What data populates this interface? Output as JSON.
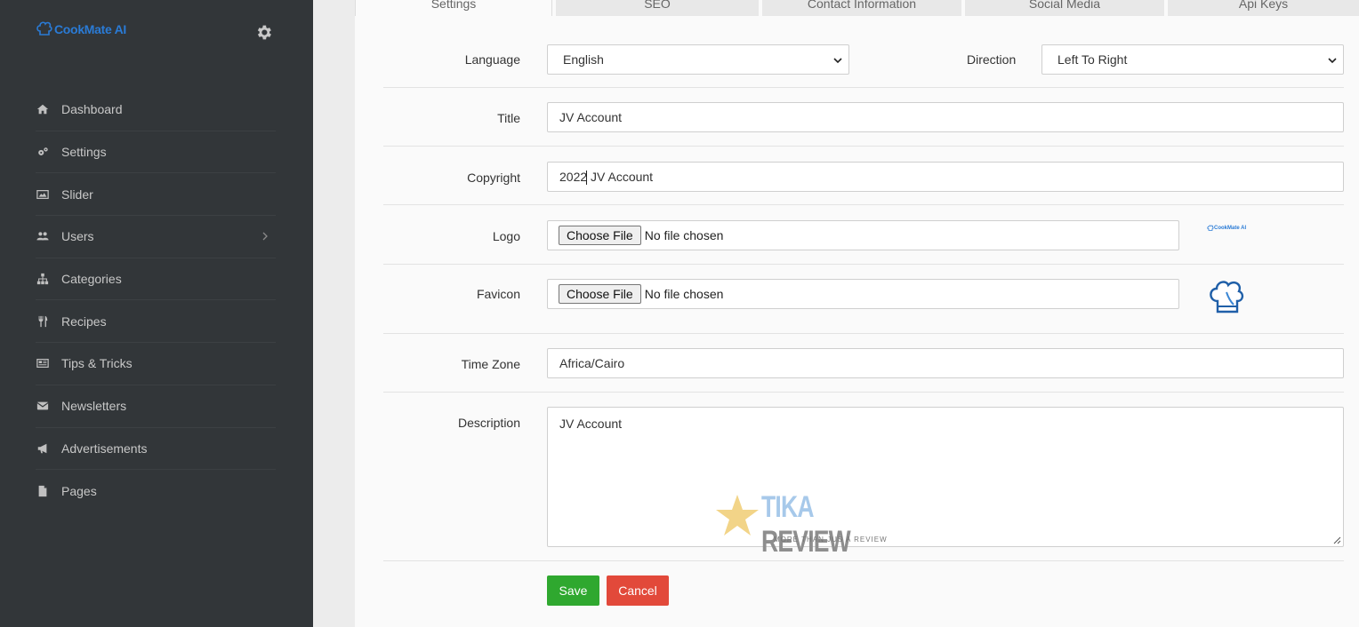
{
  "brand": {
    "name": "CookMate AI"
  },
  "sidebar": {
    "items": [
      {
        "label": "Dashboard",
        "icon": "home-icon"
      },
      {
        "label": "Settings",
        "icon": "gears-icon"
      },
      {
        "label": "Slider",
        "icon": "image-icon"
      },
      {
        "label": "Users",
        "icon": "users-icon"
      },
      {
        "label": "Categories",
        "icon": "sitemap-icon"
      },
      {
        "label": "Recipes",
        "icon": "cutlery-icon"
      },
      {
        "label": "Tips & Tricks",
        "icon": "newspaper-icon"
      },
      {
        "label": "Newsletters",
        "icon": "envelope-icon"
      },
      {
        "label": "Advertisements",
        "icon": "bullhorn-icon"
      },
      {
        "label": "Pages",
        "icon": "file-icon"
      }
    ]
  },
  "tabs": [
    "Settings",
    "SEO",
    "Contact Information",
    "Social Media",
    "Api Keys"
  ],
  "form": {
    "language": {
      "label": "Language",
      "value": "English"
    },
    "direction": {
      "label": "Direction",
      "value": "Left To Right"
    },
    "title": {
      "label": "Title",
      "value": "JV Account"
    },
    "copyright": {
      "label": "Copyright",
      "value": "2022 JV Account"
    },
    "logo": {
      "label": "Logo",
      "button": "Choose File",
      "status": "No file chosen",
      "preview": "CookMate AI"
    },
    "favicon": {
      "label": "Favicon",
      "button": "Choose File",
      "status": "No file chosen"
    },
    "timezone": {
      "label": "Time Zone",
      "value": "Africa/Cairo"
    },
    "description": {
      "label": "Description",
      "value": "JV Account"
    }
  },
  "actions": {
    "save": "Save",
    "cancel": "Cancel"
  },
  "watermark": {
    "title_part1": "TIKA",
    "title_part2": " REVIEW",
    "tagline": "MORE THAN JUS A REVIEW"
  },
  "colors": {
    "sidebar_bg": "#323639",
    "brand": "#2a7bd6",
    "save": "#2fa82f",
    "cancel": "#e2493a"
  }
}
